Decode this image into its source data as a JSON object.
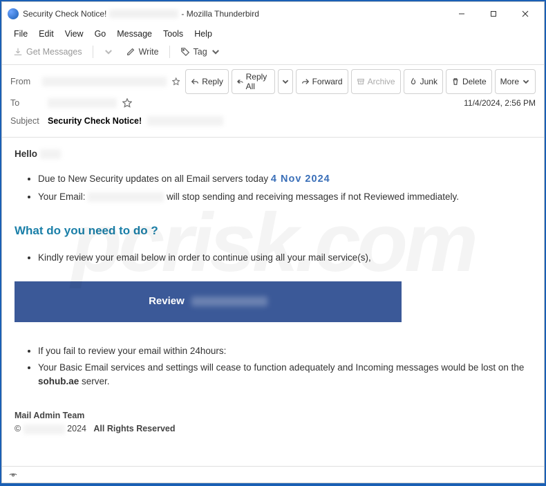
{
  "title": {
    "prefix": "Security Check Notice!",
    "suffix": "- Mozilla Thunderbird"
  },
  "menu": {
    "file": "File",
    "edit": "Edit",
    "view": "View",
    "go": "Go",
    "message": "Message",
    "tools": "Tools",
    "help": "Help"
  },
  "toolbar": {
    "get_messages": "Get Messages",
    "write": "Write",
    "tag": "Tag"
  },
  "headers": {
    "from_label": "From",
    "to_label": "To",
    "subject_label": "Subject",
    "subject_value": "Security Check Notice!",
    "date": "11/4/2024, 2:56 PM"
  },
  "actions": {
    "reply": "Reply",
    "reply_all": "Reply All",
    "forward": "Forward",
    "archive": "Archive",
    "junk": "Junk",
    "delete": "Delete",
    "more": "More"
  },
  "body": {
    "hello": "Hello",
    "bullet1_a": "Due to New Security updates on all Email servers today  ",
    "bullet1_date": "4 Nov 2024",
    "bullet2_a": "Your Email:   ",
    "bullet2_b": "  will stop sending and receiving messages if not Reviewed immediately.",
    "heading": "What do you need to do ?",
    "bullet3": "Kindly review your email below in order to continue using all your mail service(s),",
    "review_label": "Review",
    "bullet4": "If you fail to review your email within 24hours:",
    "bullet5_a": "Your Basic Email services and settings will cease to function adequately and Incoming messages would be lost on the  ",
    "bullet5_server": "sohub.ae",
    "bullet5_b": " server.",
    "sig_team": "Mail Admin Team",
    "sig_copy_a": "© ",
    "sig_copy_year": " 2024",
    "sig_rights": "All Rights Reserved"
  }
}
